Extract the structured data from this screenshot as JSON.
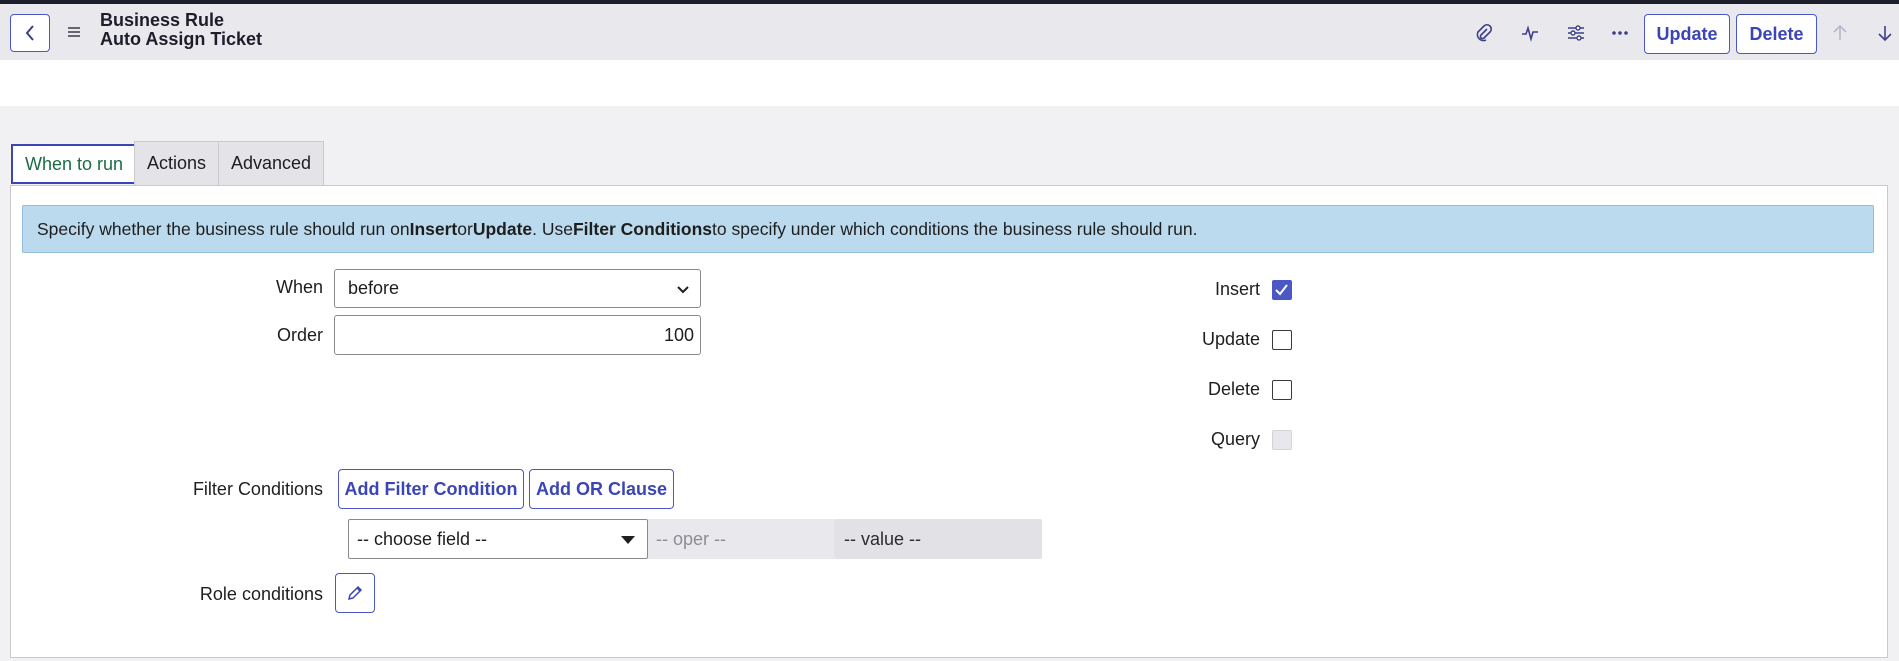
{
  "header": {
    "title_line1": "Business Rule",
    "title_line2": "Auto Assign Ticket",
    "buttons": {
      "update": "Update",
      "delete": "Delete"
    },
    "icons": [
      "back-icon",
      "menu-icon",
      "paperclip-icon",
      "activity-icon",
      "sliders-icon",
      "more-icon",
      "arrow-up-icon",
      "arrow-down-icon"
    ]
  },
  "tabs": [
    {
      "label": "When to run",
      "active": true
    },
    {
      "label": "Actions",
      "active": false
    },
    {
      "label": "Advanced",
      "active": false
    }
  ],
  "info": {
    "t1": "Specify whether the business rule should run on ",
    "b1": "Insert",
    "t2": " or ",
    "b2": "Update",
    "t3": ". Use ",
    "b3": "Filter Conditions",
    "t4": " to specify under which conditions the business rule should run."
  },
  "form": {
    "when_label": "When",
    "when_value": "before",
    "order_label": "Order",
    "order_value": "100",
    "insert_label": "Insert",
    "insert_checked": true,
    "update_label": "Update",
    "update_checked": false,
    "delete_label": "Delete",
    "delete_checked": false,
    "query_label": "Query",
    "query_disabled": true,
    "filter_label": "Filter Conditions",
    "add_filter": "Add Filter Condition",
    "add_or": "Add OR Clause",
    "choose_field": "-- choose field --",
    "oper": "-- oper --",
    "value": "-- value --",
    "role_label": "Role conditions"
  },
  "colors": {
    "accent": "#4b57c5",
    "info_bg": "#bcdaee",
    "active_tab_text": "#1a6c44"
  }
}
